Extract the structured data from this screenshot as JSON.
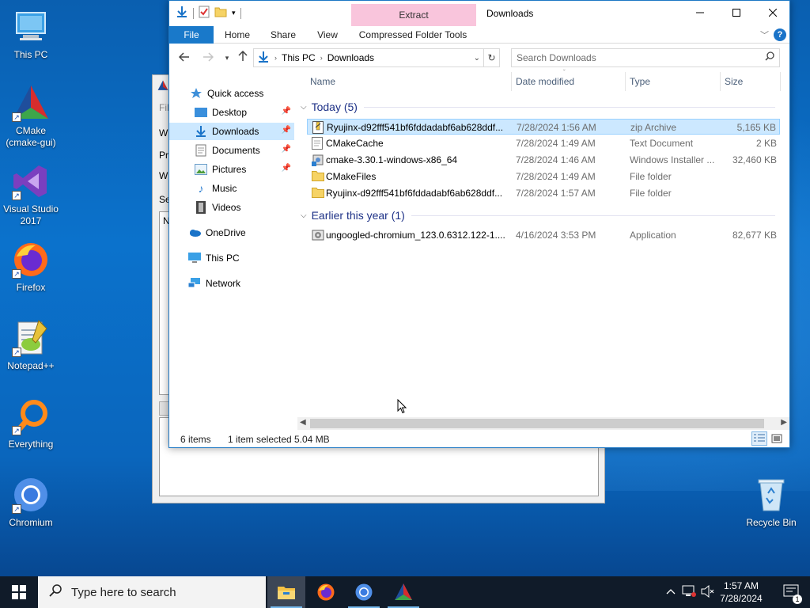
{
  "desktop": {
    "icons": [
      {
        "label": "This PC"
      },
      {
        "label": "CMake (cmake-gui)"
      },
      {
        "label": "Visual Studio 2017"
      },
      {
        "label": "Firefox"
      },
      {
        "label": "Notepad++"
      },
      {
        "label": "Everything"
      },
      {
        "label": "Chromium"
      },
      {
        "label": "Recycle Bin"
      }
    ]
  },
  "background_window": {
    "labels": [
      "Fil",
      "Wh",
      "Pre",
      "Wh",
      "Se",
      "N"
    ]
  },
  "explorer": {
    "title": "Downloads",
    "context_tab": "Extract",
    "ribbon_tabs": [
      "File",
      "Home",
      "Share",
      "View",
      "Compressed Folder Tools"
    ],
    "address": {
      "segments": [
        "This PC",
        "Downloads"
      ]
    },
    "search_placeholder": "Search Downloads",
    "nav": {
      "quick_access": "Quick access",
      "items": [
        {
          "label": "Desktop",
          "pinned": true
        },
        {
          "label": "Downloads",
          "pinned": true,
          "selected": true
        },
        {
          "label": "Documents",
          "pinned": true
        },
        {
          "label": "Pictures",
          "pinned": true
        },
        {
          "label": "Music"
        },
        {
          "label": "Videos"
        }
      ],
      "onedrive": "OneDrive",
      "thispc": "This PC",
      "network": "Network"
    },
    "columns": [
      "Name",
      "Date modified",
      "Type",
      "Size"
    ],
    "groups": [
      {
        "title": "Today (5)",
        "rows": [
          {
            "name": "Ryujinx-d92fff541bf6fddadabf6ab628ddf...",
            "date": "7/28/2024 1:56 AM",
            "type": "zip Archive",
            "size": "5,165 KB",
            "icon": "zip-icon",
            "selected": true
          },
          {
            "name": "CMakeCache",
            "date": "7/28/2024 1:49 AM",
            "type": "Text Document",
            "size": "2 KB",
            "icon": "text-file-icon"
          },
          {
            "name": "cmake-3.30.1-windows-x86_64",
            "date": "7/28/2024 1:46 AM",
            "type": "Windows Installer ...",
            "size": "32,460 KB",
            "icon": "installer-icon"
          },
          {
            "name": "CMakeFiles",
            "date": "7/28/2024 1:49 AM",
            "type": "File folder",
            "size": "",
            "icon": "folder-icon"
          },
          {
            "name": "Ryujinx-d92fff541bf6fddadabf6ab628ddf...",
            "date": "7/28/2024 1:57 AM",
            "type": "File folder",
            "size": "",
            "icon": "folder-icon"
          }
        ]
      },
      {
        "title": "Earlier this year (1)",
        "rows": [
          {
            "name": "ungoogled-chromium_123.0.6312.122-1....",
            "date": "4/16/2024 3:53 PM",
            "type": "Application",
            "size": "82,677 KB",
            "icon": "application-icon"
          }
        ]
      }
    ],
    "status": {
      "items": "6 items",
      "selected": "1 item selected",
      "size": "5.04 MB"
    }
  },
  "taskbar": {
    "search_placeholder": "Type here to search",
    "time": "1:57 AM",
    "date": "7/28/2024",
    "notification_count": "1"
  }
}
